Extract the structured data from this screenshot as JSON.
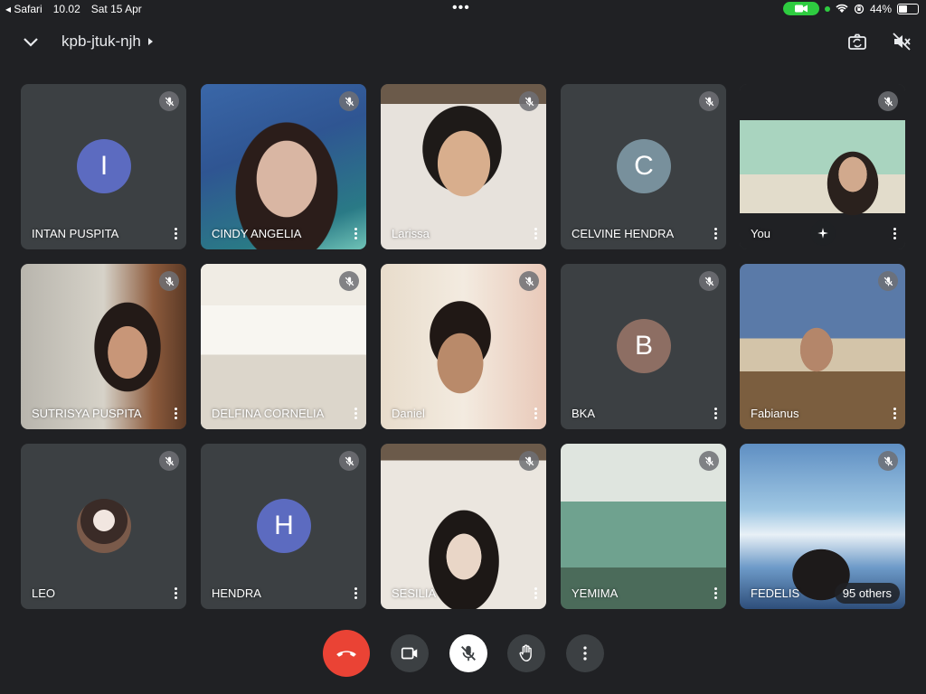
{
  "status_bar": {
    "back_app": "Safari",
    "time": "10.02",
    "date": "Sat 15 Apr",
    "battery": "44%",
    "battery_level": 0.44
  },
  "header": {
    "meeting_code": "kpb-jtuk-njh"
  },
  "participants": [
    {
      "name": "INTAN PUSPITA",
      "type": "letter",
      "letter": "I",
      "avatar_color": "#5c6bc0"
    },
    {
      "name": "CINDY ANGELIA",
      "type": "video"
    },
    {
      "name": "Larissa",
      "type": "video"
    },
    {
      "name": "CELVINE HENDRA",
      "type": "letter",
      "letter": "C",
      "avatar_color": "#78909c"
    },
    {
      "name": "You",
      "type": "video"
    },
    {
      "name": "SUTRISYA PUSPITA",
      "type": "video"
    },
    {
      "name": "DELFINA CORNELIA",
      "type": "video"
    },
    {
      "name": "Daniel",
      "type": "video"
    },
    {
      "name": "BKA",
      "type": "letter",
      "letter": "B",
      "avatar_color": "#8d6e63"
    },
    {
      "name": "Fabianus",
      "type": "video"
    },
    {
      "name": "LEO",
      "type": "photo"
    },
    {
      "name": "HENDRA",
      "type": "letter",
      "letter": "H",
      "avatar_color": "#5c6bc0"
    },
    {
      "name": "SESILIA",
      "type": "video"
    },
    {
      "name": "YEMIMA",
      "type": "video"
    },
    {
      "name": "FEDELIS",
      "type": "video",
      "others": "95 others"
    }
  ],
  "colors": {
    "background": "#202124",
    "tile": "#3c4043",
    "end_call": "#ea4335"
  }
}
